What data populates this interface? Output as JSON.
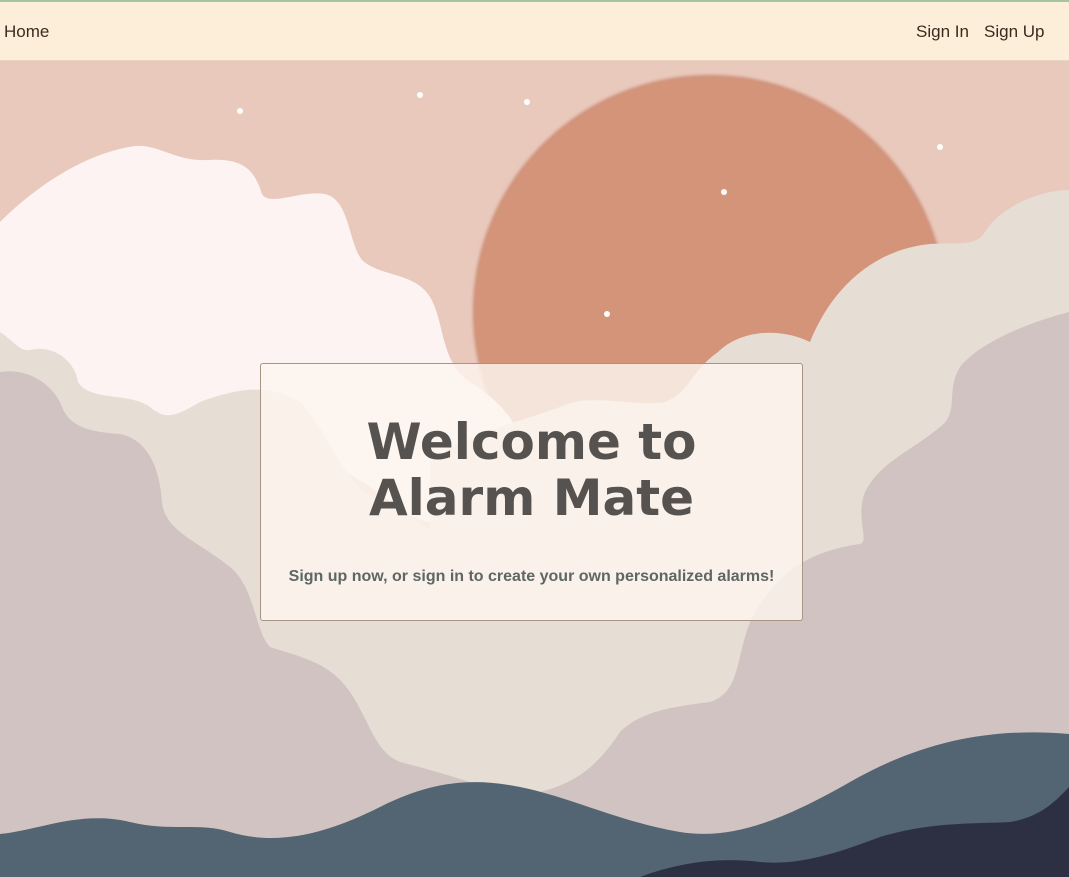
{
  "nav": {
    "home": "Home",
    "sign_in": "Sign In",
    "sign_up": "Sign Up"
  },
  "hero": {
    "title": "Welcome to Alarm Mate",
    "subtitle": "Sign up now, or sign in to create your own personalized alarms!"
  },
  "colors": {
    "navbar_bg": "#fdeed9",
    "sky": "#e9c9bc",
    "sun": "#d4947a",
    "cloud_light": "#fcf3f2",
    "cloud_mid": "#e6ddd5",
    "cloud_back": "#d1c3c1",
    "hill_blue": "#536472",
    "hill_dark": "#2d3043"
  }
}
